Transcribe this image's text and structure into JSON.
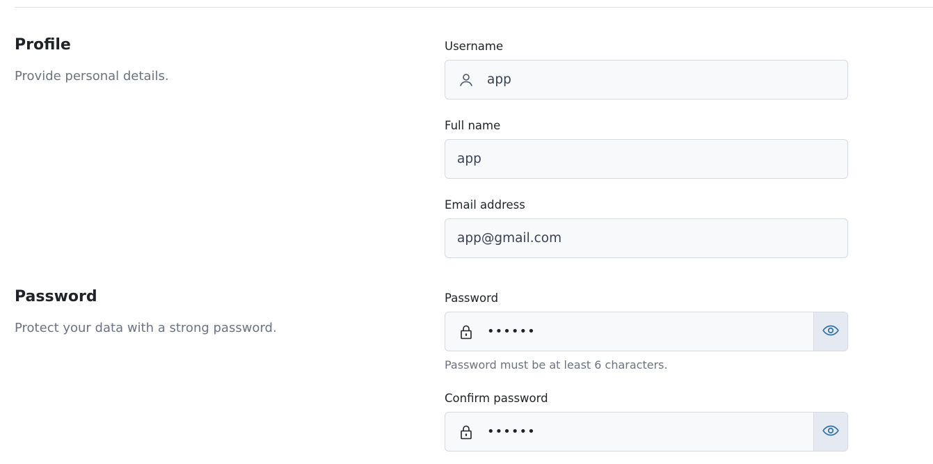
{
  "profile": {
    "title": "Profile",
    "description": "Provide personal details.",
    "username": {
      "label": "Username",
      "value": "app"
    },
    "full_name": {
      "label": "Full name",
      "value": "app"
    },
    "email": {
      "label": "Email address",
      "value": "app@gmail.com"
    }
  },
  "password_section": {
    "title": "Password",
    "description": "Protect your data with a strong password.",
    "password": {
      "label": "Password",
      "value": "••••••",
      "hint": "Password must be at least 6 characters."
    },
    "confirm": {
      "label": "Confirm password",
      "value": "••••••"
    }
  },
  "icons": {
    "username": "user-icon",
    "password": "lock-icon",
    "toggle": "eye-icon"
  },
  "colors": {
    "accent": "#2f6fa7",
    "input_bg": "#f8f9fb",
    "toggle_bg": "#e5eaf2"
  }
}
